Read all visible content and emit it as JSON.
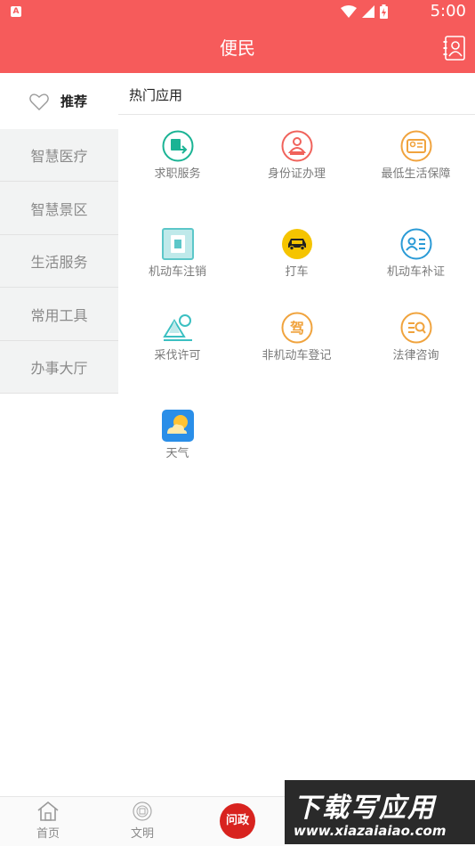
{
  "status_bar": {
    "badge": "A",
    "time": "5:00"
  },
  "header": {
    "title": "便民"
  },
  "sidebar": {
    "items": [
      {
        "label": "推荐"
      },
      {
        "label": "智慧医疗"
      },
      {
        "label": "智慧景区"
      },
      {
        "label": "生活服务"
      },
      {
        "label": "常用工具"
      },
      {
        "label": "办事大厅"
      }
    ]
  },
  "main": {
    "section_title": "热门应用",
    "apps": [
      {
        "label": "求职服务",
        "icon": "job-icon",
        "color": "#1ab394"
      },
      {
        "label": "身份证办理",
        "icon": "id-card-icon",
        "color": "#f0625b"
      },
      {
        "label": "最低生活保障",
        "icon": "allowance-icon",
        "color": "#f0a33d"
      },
      {
        "label": "机动车注销",
        "icon": "vehicle-cancel-icon",
        "color": "#5cc7c9"
      },
      {
        "label": "打车",
        "icon": "taxi-icon",
        "color": "#f5c400"
      },
      {
        "label": "机动车补证",
        "icon": "vehicle-reissue-icon",
        "color": "#2a9ad6"
      },
      {
        "label": "采伐许可",
        "icon": "logging-icon",
        "color": "#3bc0c2"
      },
      {
        "label": "非机动车登记",
        "icon": "bicycle-register-icon",
        "color": "#f0a33d"
      },
      {
        "label": "法律咨询",
        "icon": "legal-icon",
        "color": "#f0a33d"
      },
      {
        "label": "天气",
        "icon": "weather-icon",
        "color": "#2a8ee8"
      }
    ]
  },
  "bottom_nav": {
    "items": [
      {
        "label": "首页",
        "icon": "home-icon"
      },
      {
        "label": "文明",
        "icon": "civilization-icon"
      },
      {
        "label": "问政",
        "icon": "wenzheng-icon"
      }
    ]
  },
  "watermark": {
    "title": "下载写应用",
    "url": "www.xiazaiaiao.com"
  },
  "colors": {
    "accent": "#f65b5b",
    "sidebar_bg": "#f2f3f3"
  }
}
